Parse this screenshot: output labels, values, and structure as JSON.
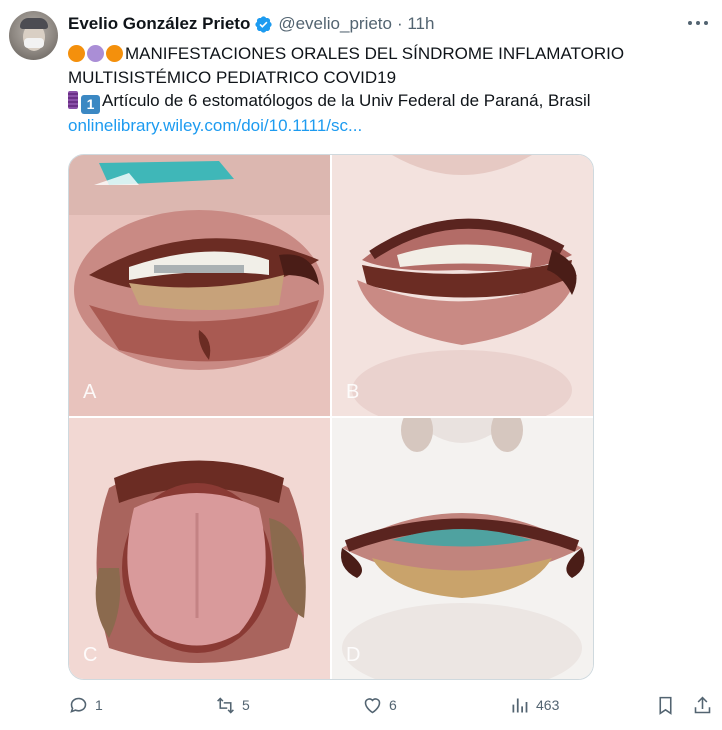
{
  "tweet": {
    "author_name": "Evelio González Prieto",
    "handle": "@evelio_prieto",
    "time": "· 11h",
    "line1_text": "MANIFESTACIONES ORALES DEL SÍNDROME INFLAMATORIO",
    "line2_text": "MULTISISTÉMICO PEDIATRICO COVID19",
    "line3_text": "Artículo de 6 estomatólogos de la Univ Federal de Paraná, Brasil",
    "keycap": "1",
    "link": "onlinelibrary.wiley.com/doi/10.1111/sc...",
    "emoji_colors": [
      "#f4900c",
      "#aa8ed6",
      "#f4900c"
    ]
  },
  "media": {
    "labels": [
      "A",
      "B",
      "C",
      "D"
    ]
  },
  "actions": {
    "replies": "1",
    "reposts": "5",
    "likes": "6",
    "views": "463"
  },
  "icons": [
    "verified-badge-icon",
    "more-icon",
    "reply-icon",
    "repost-icon",
    "like-icon",
    "views-icon",
    "bookmark-icon",
    "share-icon"
  ]
}
